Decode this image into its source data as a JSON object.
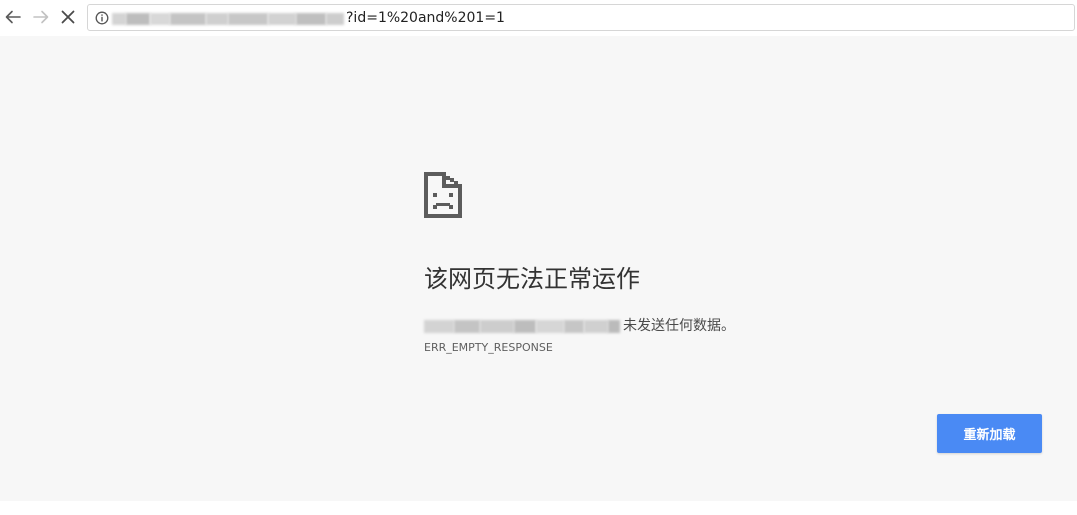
{
  "toolbar": {
    "back_icon": "arrow-left-icon",
    "forward_icon": "arrow-right-icon",
    "stop_icon": "close-icon",
    "info_icon": "info-icon",
    "url_visible_suffix": "?id=1%20and%201=1"
  },
  "error_page": {
    "icon": "sad-page-icon",
    "title": "该网页无法正常运作",
    "host_message": "未发送任何数据。",
    "error_code": "ERR_EMPTY_RESPONSE",
    "reload_label": "重新加载"
  },
  "colors": {
    "accent": "#4a8af4",
    "page_background": "#f7f7f7",
    "heading_text": "#333333"
  }
}
